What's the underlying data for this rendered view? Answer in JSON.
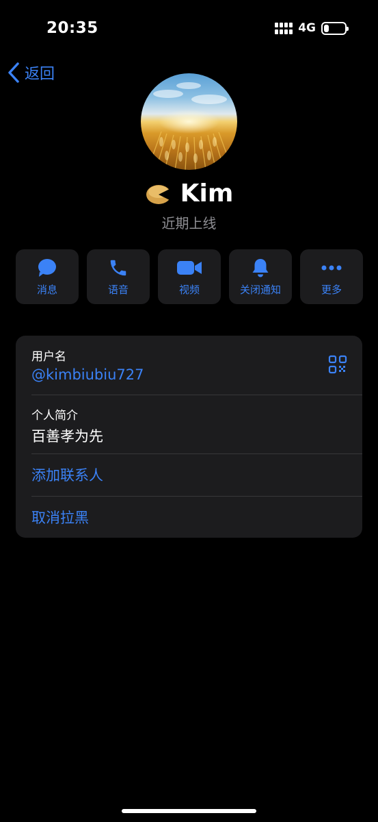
{
  "status_bar": {
    "time": "20:35",
    "network": "4G",
    "battery_percent": 25
  },
  "nav": {
    "back_label": "返回"
  },
  "profile": {
    "name": "Kim",
    "status": "近期上线"
  },
  "actions": [
    {
      "label": "消息",
      "icon": "message-bubble-icon"
    },
    {
      "label": "语音",
      "icon": "phone-icon"
    },
    {
      "label": "视频",
      "icon": "video-camera-icon"
    },
    {
      "label": "关闭通知",
      "icon": "bell-icon"
    },
    {
      "label": "更多",
      "icon": "more-dots-icon"
    }
  ],
  "info": {
    "username_label": "用户名",
    "username": "@kimbiubiu727",
    "bio_label": "个人简介",
    "bio": "百善孝为先",
    "add_contact": "添加联系人",
    "unblock": "取消拉黑"
  },
  "colors": {
    "accent": "#3b82f6",
    "card_bg": "#1c1c1e",
    "secondary_text": "#8e8e93",
    "background": "#000000"
  }
}
